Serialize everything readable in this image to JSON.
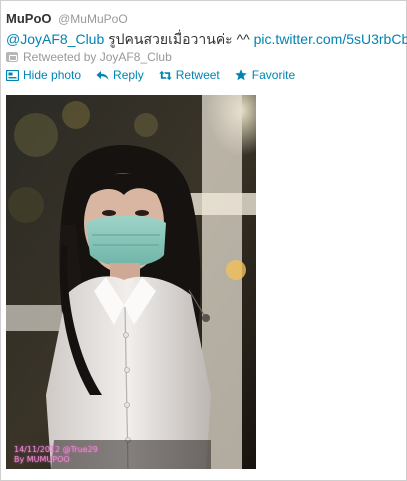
{
  "user": {
    "name": "MuPoO",
    "handle": "@MuMuPoO"
  },
  "tweet": {
    "mention": "@JoyAF8_Club",
    "text": " รูปคนสวยเมื่อวานค่ะ ^^ ",
    "link": "pic.twitter.com/5sU3rbCb"
  },
  "retweet": {
    "text": "Retweeted by JoyAF8_Club",
    "icon": "retweet-badge-icon"
  },
  "actions": [
    {
      "label": "Hide photo",
      "icon": "photo-icon"
    },
    {
      "label": "Reply",
      "icon": "reply-icon"
    },
    {
      "label": "Retweet",
      "icon": "retweet-icon"
    },
    {
      "label": "Favorite",
      "icon": "star-icon"
    }
  ],
  "photo": {
    "watermark_line1": "14/11/2012 @True29",
    "watermark_line2": "By MUMUPOO"
  },
  "colors": {
    "link": "#0084b4",
    "muted": "#999999",
    "text": "#333333",
    "border": "#cfcfcf"
  }
}
